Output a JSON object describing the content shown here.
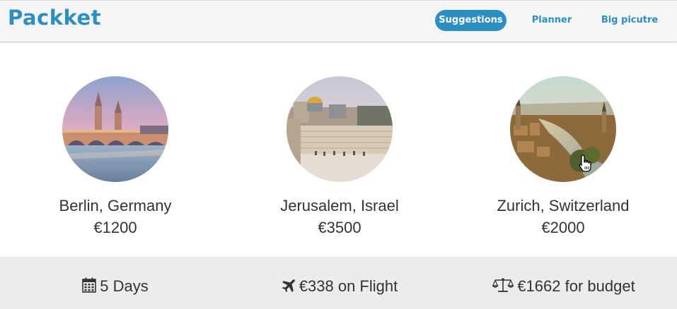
{
  "brand": {
    "title": "Packket",
    "color": "#2c8fc1"
  },
  "nav": {
    "items": [
      {
        "label": "Suggestions",
        "active": true
      },
      {
        "label": "Planner",
        "active": false
      },
      {
        "label": "Big picutre",
        "active": false
      }
    ]
  },
  "destinations": [
    {
      "name": "Berlin, Germany",
      "price": "€1200",
      "image": "berlin-oberbaum-bridge"
    },
    {
      "name": "Jerusalem, Israel",
      "price": "€3500",
      "image": "jerusalem-western-wall"
    },
    {
      "name": "Zurich, Switzerland",
      "price": "€2000",
      "image": "zurich-city-view"
    }
  ],
  "stats": {
    "days": {
      "icon": "calendar-icon",
      "text": "5 Days"
    },
    "flight": {
      "icon": "plane-icon",
      "text": "€338 on Flight"
    },
    "budget": {
      "icon": "balance-scale-icon",
      "text": "€1662 for budget"
    }
  }
}
